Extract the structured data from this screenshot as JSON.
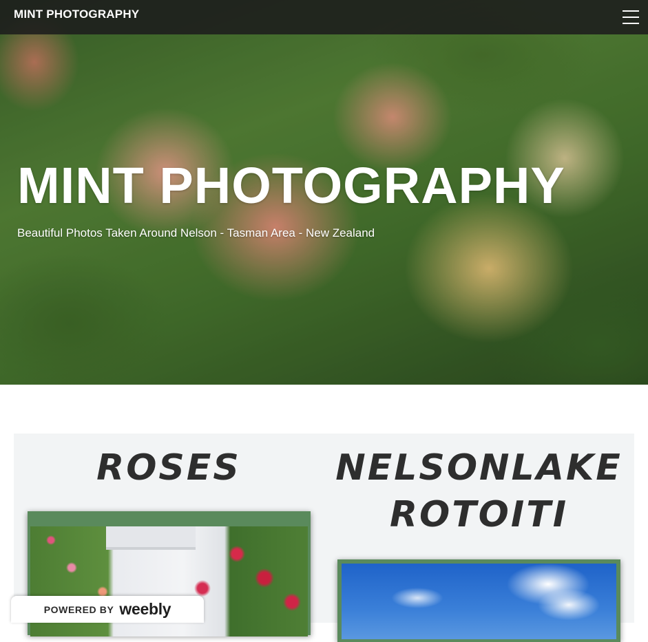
{
  "nav": {
    "brand": "MINT PHOTOGRAPHY",
    "menu_icon": "hamburger-menu-icon"
  },
  "hero": {
    "title": "MINT PHOTOGRAPHY",
    "subtitle": "Beautiful Photos Taken Around Nelson - Tasman Area - New Zealand"
  },
  "gallery": {
    "columns": [
      {
        "title": "ROSES"
      },
      {
        "title": "NELSONLAKE ROTOITI"
      }
    ]
  },
  "footer_badge": {
    "powered_label": "POWERED BY",
    "brand": "weebly"
  },
  "colors": {
    "nav_bg": "#1c1c1c",
    "frame_green": "#5a8a5c",
    "section_bg": "#f2f4f5",
    "heading_text": "#2e2e2e"
  }
}
